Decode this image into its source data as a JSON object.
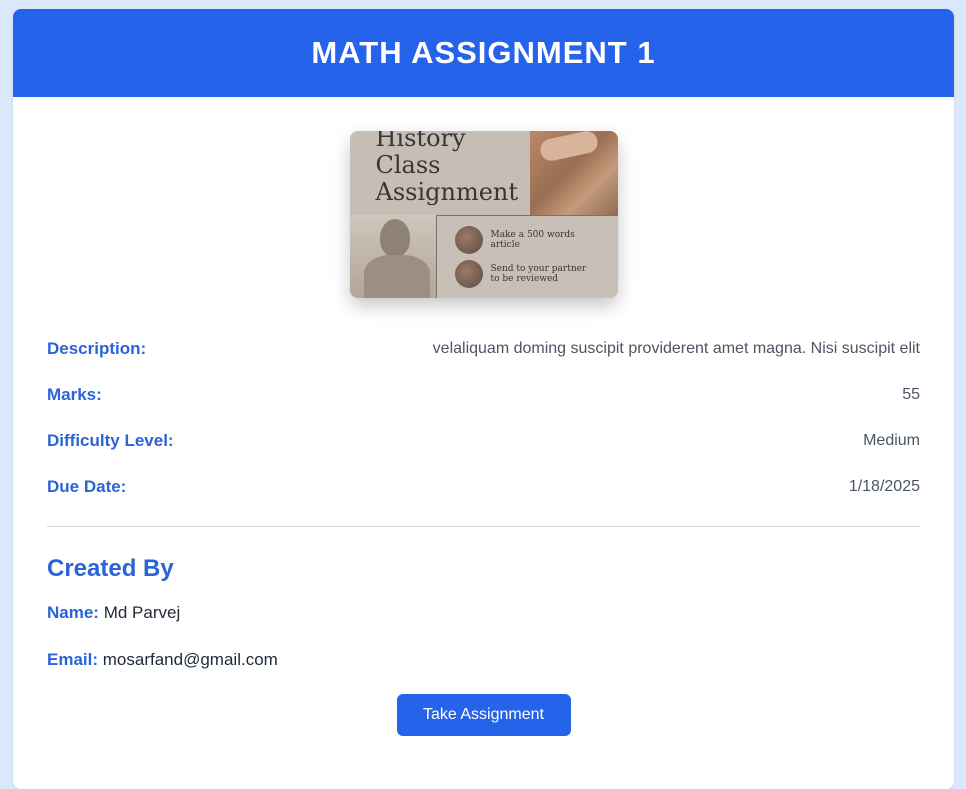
{
  "header": {
    "title": "MATH ASSIGNMENT 1"
  },
  "thumbnail": {
    "title_lines": [
      "History",
      "Class",
      "Assignment"
    ],
    "items": [
      "Make a 500 words article",
      "Send to your partner to be reviewed"
    ]
  },
  "details": [
    {
      "label": "Description:",
      "value": "velaliquam doming suscipit providerent amet magna. Nisi suscipit elit"
    },
    {
      "label": "Marks:",
      "value": "55"
    },
    {
      "label": "Difficulty Level:",
      "value": "Medium"
    },
    {
      "label": "Due Date:",
      "value": "1/18/2025"
    }
  ],
  "creator": {
    "heading": "Created By",
    "name_label": "Name:",
    "name": "Md Parvej",
    "email_label": "Email:",
    "email": "mosarfand@gmail.com"
  },
  "actions": {
    "take_label": "Take Assignment"
  },
  "colors": {
    "primary": "#2563eb",
    "label": "#2b63d9",
    "background": "#dbe8fb"
  }
}
